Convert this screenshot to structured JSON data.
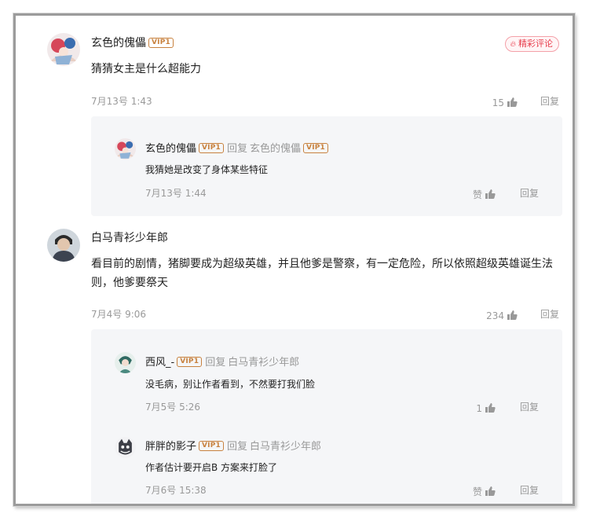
{
  "comments": [
    {
      "user": "玄色的傀儡",
      "vip": "VIP1",
      "badge": "精彩评论",
      "content": "猜猜女主是什么超能力",
      "date": "7月13号 1:43",
      "likes": "15",
      "reply_label": "回复",
      "replies": [
        {
          "user": "玄色的傀儡",
          "vip": "VIP1",
          "reply_word": "回复",
          "reply_to": "玄色的傀儡",
          "reply_to_vip": "VIP1",
          "content": "我猜她是改变了身体某些特征",
          "date": "7月13号 1:44",
          "likes": "赞",
          "reply_label": "回复"
        }
      ]
    },
    {
      "user": "白马青衫少年郎",
      "content_line1": "看目前的剧情，猪脚要成为超级英雄，并且他爹是警察，有一定危险，所以依照超级英雄诞生法",
      "content_line2": "则，他爹要祭天",
      "date": "7月4号 9:06",
      "likes": "234",
      "reply_label": "回复",
      "replies": [
        {
          "user": "西风_-",
          "vip": "VIP1",
          "reply_word": "回复",
          "reply_to": "白马青衫少年郎",
          "content": "没毛病，别让作者看到，不然要打我们脸",
          "date": "7月5号 5:26",
          "likes": "1",
          "reply_label": "回复"
        },
        {
          "user": "胖胖的影子",
          "vip": "VIP1",
          "reply_word": "回复",
          "reply_to": "白马青衫少年郎",
          "content": "作者估计要开启B 方案来打脸了",
          "date": "7月6号 15:38",
          "likes": "赞",
          "reply_label": "回复"
        }
      ]
    }
  ],
  "icons": {
    "like": "thumbs-up-icon",
    "badge": "flame-icon"
  },
  "colors": {
    "vip": "#c8823f",
    "badge": "#e8404f",
    "muted": "#999999",
    "reply_bg": "#f5f6f8"
  }
}
